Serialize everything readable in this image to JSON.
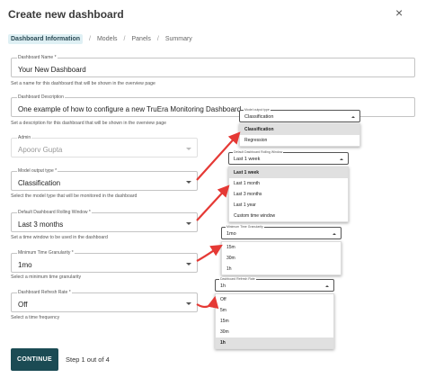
{
  "header": {
    "title": "Create new dashboard"
  },
  "steps": [
    "Dashboard Information",
    "Models",
    "Panels",
    "Summary"
  ],
  "form": {
    "name": {
      "label": "Dashboard Name *",
      "value": "Your New Dashboard",
      "helper": "Set a name for this dashboard that will be shown in the overview page"
    },
    "description": {
      "label": "Dashboard Description",
      "value": "One example of how to configure a new TruEra Monitoring Dashboard",
      "helper": "Set a description for this dashboard that will be shown in the overview page"
    },
    "admin": {
      "label": "Admin",
      "value": "Apoorv Gupta"
    },
    "model_output": {
      "label": "Model output type *",
      "value": "Classification",
      "helper": "Select the model type that will be monitored in the dashboard"
    },
    "rolling_window": {
      "label": "Default Dashboard Rolling Window *",
      "value": "Last 3 months",
      "helper": "Set a time window to be used in the dashboard"
    },
    "granularity": {
      "label": "Minimum Time Granularity *",
      "value": "1mo",
      "helper": "Select a minimum time granularity"
    },
    "refresh": {
      "label": "Dashboard Refresh Rate *",
      "value": "Off",
      "helper": "Select a time frequency"
    }
  },
  "footer": {
    "continue_label": "CONTINUE",
    "step_text": "Step 1 out of 4"
  },
  "popups": {
    "model_output": {
      "label": "Model output type",
      "value": "Classification",
      "options": [
        "Classification",
        "Regression"
      ]
    },
    "rolling_window": {
      "label": "Default Dashboard Rolling Window",
      "value": "Last 1 week",
      "options": [
        "Last 1 week",
        "Last 1 month",
        "Last 3 months",
        "Last 1 year",
        "Custom time window"
      ]
    },
    "granularity": {
      "label": "Minimum Time Granularity",
      "value": "1mo",
      "options": [
        "15m",
        "30m",
        "1h"
      ]
    },
    "refresh": {
      "label": "Dashboard Refresh Rate",
      "value": "1h",
      "options": [
        "Off",
        "5m",
        "15m",
        "30m",
        "1h"
      ]
    }
  },
  "colors": {
    "accent": "#1b4b54",
    "arrow": "#e53935",
    "step_active_bg": "#dff0f4"
  }
}
